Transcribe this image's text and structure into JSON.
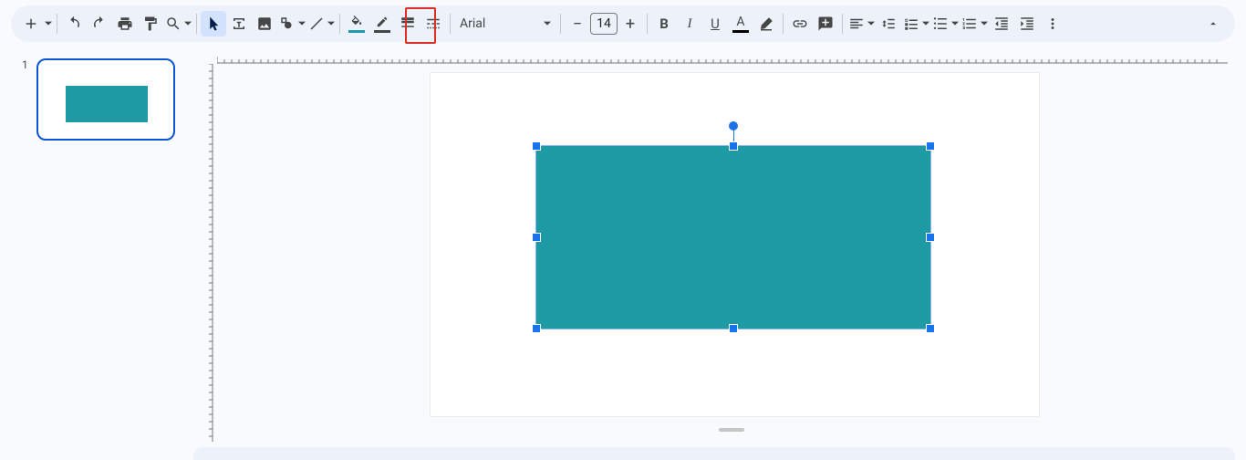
{
  "toolbar": {
    "font_name": "Arial",
    "font_size": "14",
    "fill_swatch": "#1e9aa5",
    "border_swatch": "#444746",
    "text_swatch": "#000000"
  },
  "slides": {
    "thumb1_number": "1"
  },
  "shape": {
    "fill": "#1e9aa5"
  }
}
